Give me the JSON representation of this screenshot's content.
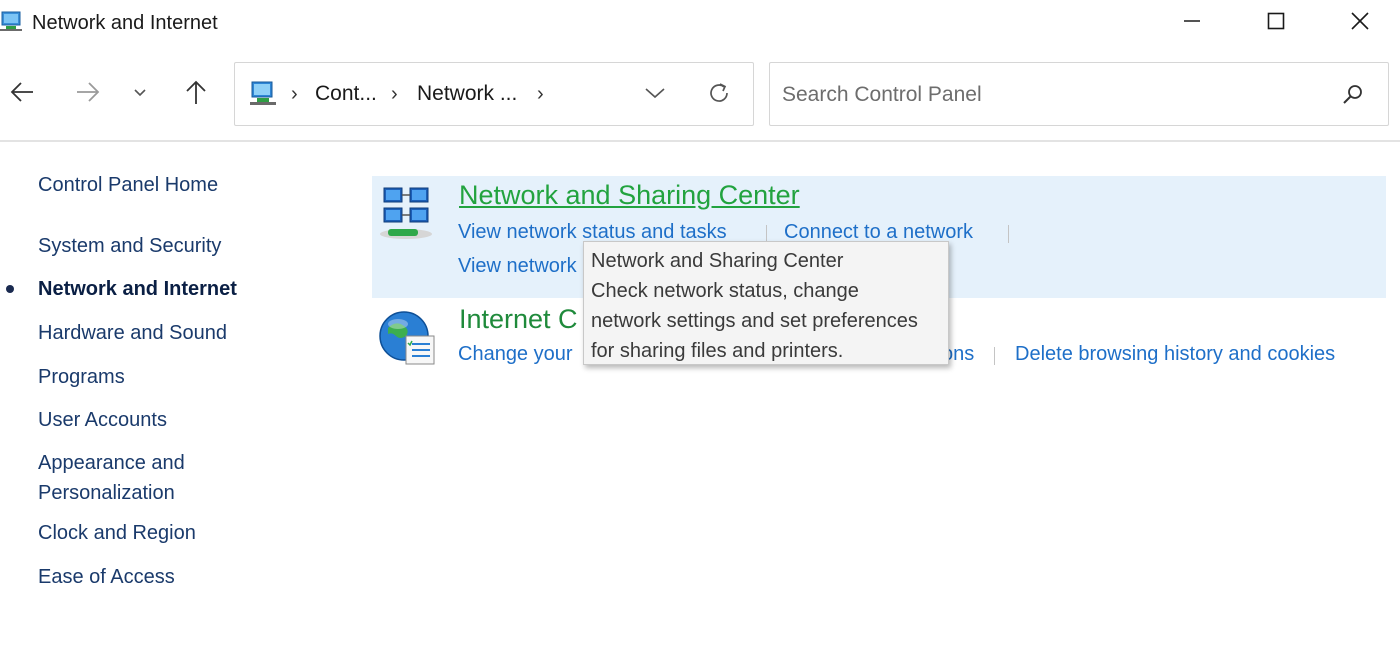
{
  "window": {
    "title": "Network and Internet",
    "controls": [
      "minimize",
      "maximize",
      "close"
    ]
  },
  "navigation": {
    "breadcrumbs": [
      "Cont...",
      "Network ..."
    ],
    "search_placeholder": "Search Control Panel"
  },
  "sidebar": {
    "home": "Control Panel Home",
    "items": [
      {
        "label": "System and Security",
        "current": false
      },
      {
        "label": "Network and Internet",
        "current": true
      },
      {
        "label": "Hardware and Sound",
        "current": false
      },
      {
        "label": "Programs",
        "current": false
      },
      {
        "label": "User Accounts",
        "current": false
      },
      {
        "label": "Appearance and Personalization",
        "lines": [
          "Appearance and",
          "Personalization"
        ],
        "current": false
      },
      {
        "label": "Clock and Region",
        "current": false
      },
      {
        "label": "Ease of Access",
        "current": false
      }
    ]
  },
  "categories": [
    {
      "title": "Network and Sharing Center",
      "icon": "network-sharing-icon",
      "hovered": true,
      "tasks": [
        "View network status and tasks",
        "Connect to a network",
        "View network"
      ]
    },
    {
      "title": "Internet C",
      "icon": "internet-options-icon",
      "hovered": false,
      "tasks": [
        "Change your",
        "ons",
        "Delete browsing history and cookies"
      ]
    }
  ],
  "tooltip": {
    "lines": [
      "Network and Sharing Center",
      "Check network status, change",
      "network settings and set preferences",
      "for sharing files and printers."
    ]
  },
  "colors": {
    "category_title": "#1f8a3b",
    "task_link": "#1e6fc8",
    "hover_background": "#e5f1fb",
    "sidebar_link": "#1a3a6b"
  }
}
